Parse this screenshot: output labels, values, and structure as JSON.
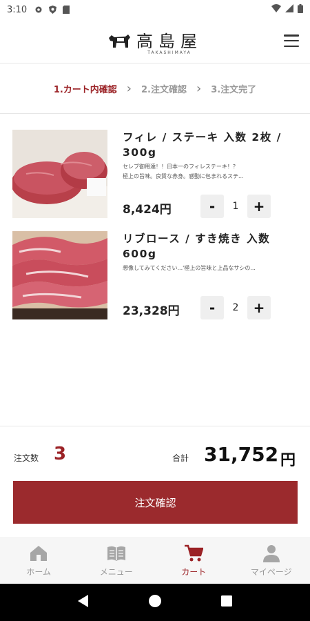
{
  "status_bar": {
    "time": "3:10",
    "icons": [
      "gear-icon",
      "shield-icon",
      "sd-card-icon"
    ],
    "right_icons": [
      "wifi-icon",
      "signal-icon",
      "battery-icon"
    ]
  },
  "header": {
    "logo_text": "高島屋",
    "logo_sub": "TAKASHIMAYA",
    "logo_icon": "bull-icon",
    "menu_icon": "hamburger-icon"
  },
  "steps": [
    {
      "label": "1.カート内確認",
      "active": true
    },
    {
      "label": "2.注文確認",
      "active": false
    },
    {
      "label": "3.注文完了",
      "active": false
    }
  ],
  "items": [
    {
      "name": "フィレ / ステーキ 入数 2枚 / 300g",
      "desc_line1": "セレブ御用達！！日本一のフィレステーキ！？",
      "desc_line2": "極上の旨味。良質な赤身。感動に包まれるステ...",
      "price": "8,424円",
      "qty": "1",
      "minus": "-",
      "plus": "+"
    },
    {
      "name": "リブロース / すき焼き 入数 600g",
      "desc_line1": "想像してみてください...'極上の旨味と上品なサシの...",
      "price": "23,328円",
      "qty": "2",
      "minus": "-",
      "plus": "+"
    }
  ],
  "summary": {
    "count_label": "注文数",
    "count_value": "3",
    "total_label": "合計",
    "total_value": "31,752",
    "total_unit": "円",
    "confirm_button": "注文確認"
  },
  "bottom_nav": [
    {
      "label": "ホーム",
      "icon": "home-icon",
      "active": false
    },
    {
      "label": "メニュー",
      "icon": "menu-book-icon",
      "active": false
    },
    {
      "label": "カート",
      "icon": "cart-icon",
      "active": true
    },
    {
      "label": "マイページ",
      "icon": "person-icon",
      "active": false
    }
  ],
  "colors": {
    "accent": "#9b2226",
    "button": "#9b2a2d",
    "nav_bg": "#f6f6f6",
    "qty_bg": "#efefef"
  }
}
